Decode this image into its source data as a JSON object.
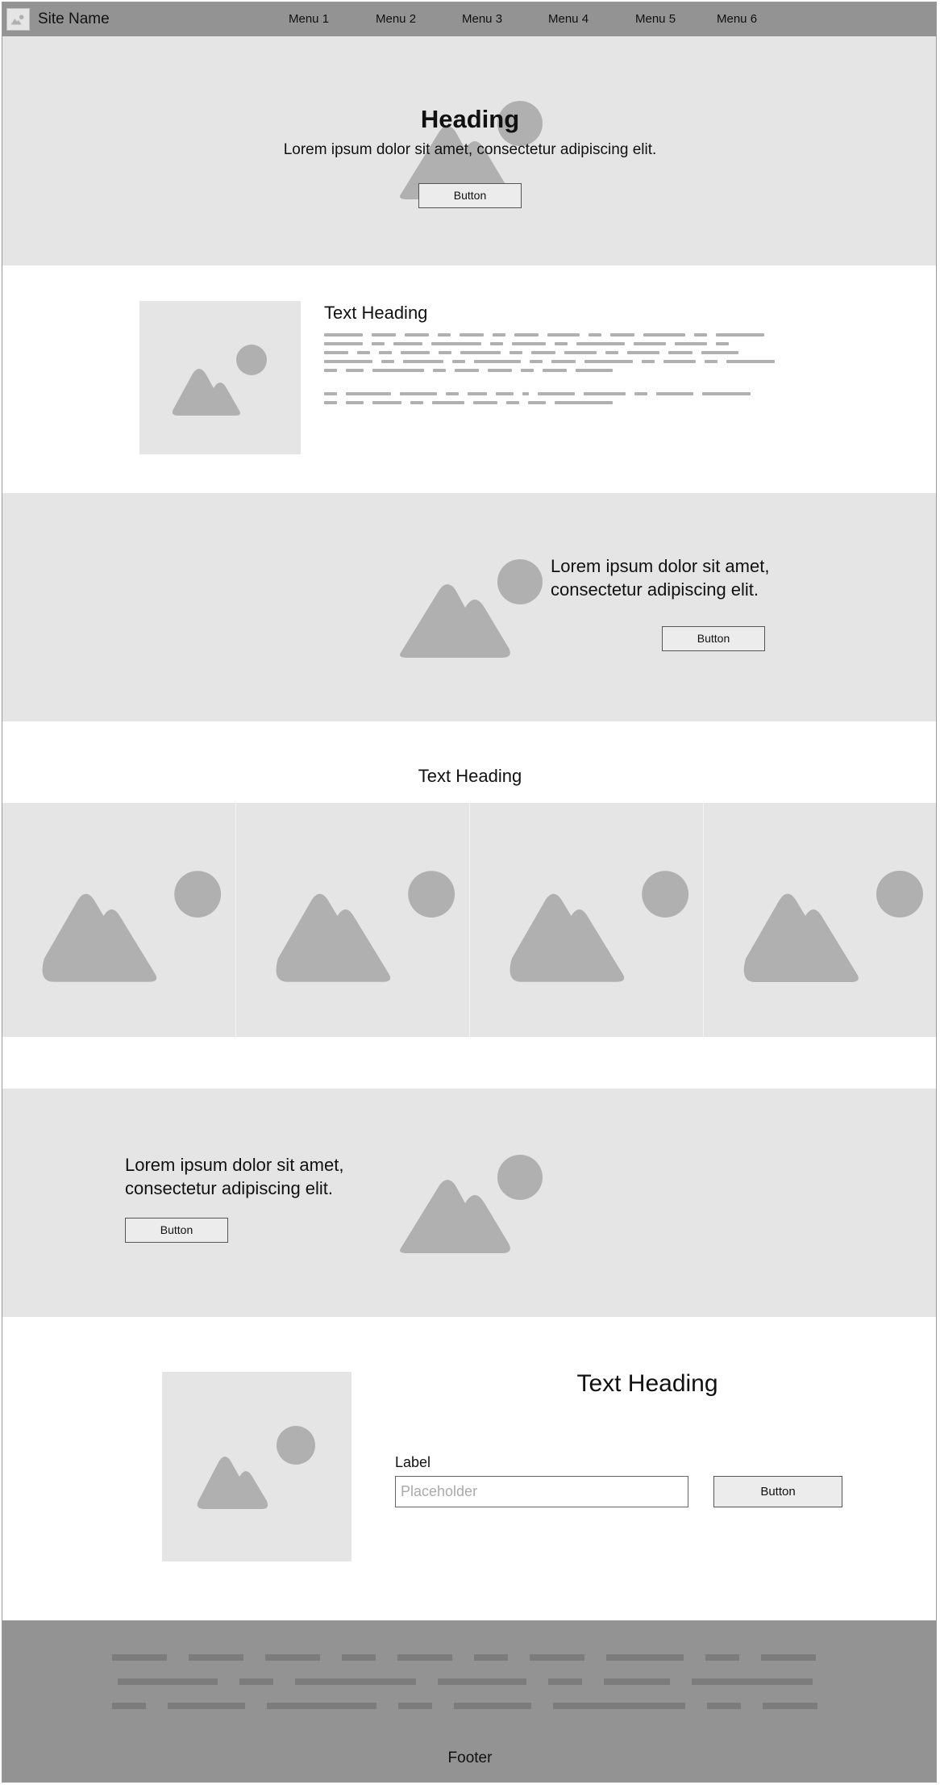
{
  "header": {
    "site_name": "Site Name",
    "menu": [
      "Menu 1",
      "Menu 2",
      "Menu 3",
      "Menu 4",
      "Menu 5",
      "Menu 6"
    ]
  },
  "hero": {
    "heading": "Heading",
    "subtext": "Lorem ipsum dolor sit amet, consectetur adipiscing elit.",
    "button": "Button"
  },
  "text_block": {
    "heading": "Text Heading"
  },
  "feature_right": {
    "text": "Lorem ipsum dolor sit amet, consectetur adipiscing elit.",
    "button": "Button"
  },
  "gallery": {
    "heading": "Text Heading"
  },
  "feature_left": {
    "text": "Lorem ipsum dolor sit amet, consectetur adipiscing elit.",
    "button": "Button"
  },
  "form_section": {
    "heading": "Text Heading",
    "label": "Label",
    "placeholder": "Placeholder",
    "button": "Button"
  },
  "footer": {
    "text": "Footer"
  },
  "colors": {
    "header_bg": "#939393",
    "band_gray": "#e5e5e5",
    "image_shape": "#b0b0b0",
    "footer_bg": "#939393"
  }
}
